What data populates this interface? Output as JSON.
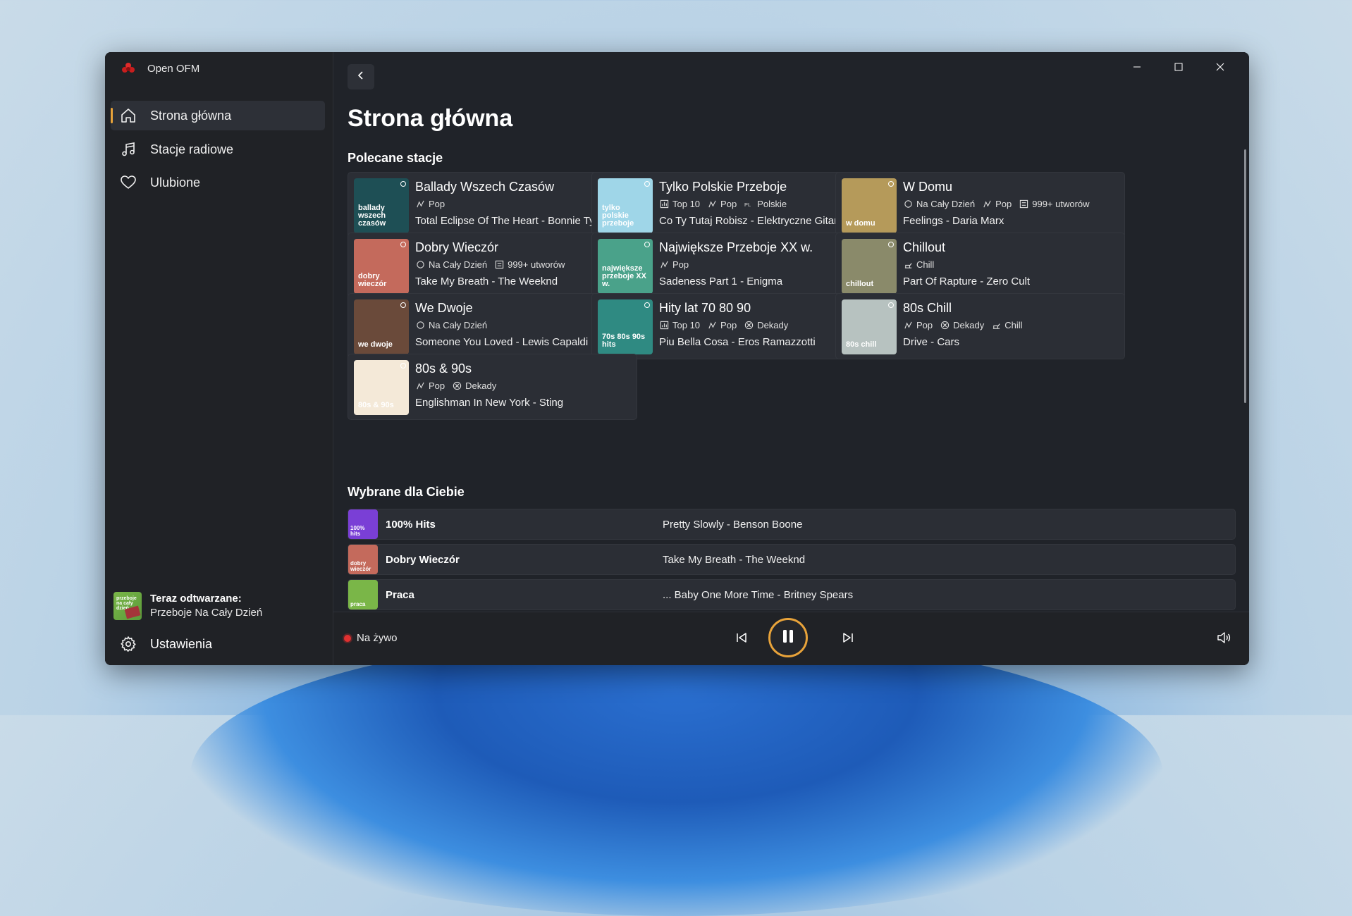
{
  "app": {
    "title": "Open OFM"
  },
  "nav": [
    {
      "label": "Strona główna",
      "icon": "home-icon",
      "active": true
    },
    {
      "label": "Stacje radiowe",
      "icon": "music-note-icon",
      "active": false
    },
    {
      "label": "Ulubione",
      "icon": "heart-icon",
      "active": false
    }
  ],
  "now_playing": {
    "label": "Teraz odtwarzane:",
    "station": "Przeboje Na Cały Dzień",
    "art_text": "przeboje na cały dzień"
  },
  "settings": {
    "label": "Ustawienia"
  },
  "main": {
    "title": "Strona główna",
    "featured_title": "Polecane stacje",
    "picked_title": "Wybrane dla Ciebie"
  },
  "featured": [
    {
      "name": "Ballady Wszech Czasów",
      "art_text": "ballady wszech czasów",
      "art_color": "#1e4f55",
      "tags": [
        {
          "icon": "genre-icon",
          "label": "Pop"
        }
      ],
      "song": "Total Eclipse Of The Heart - Bonnie Tyler"
    },
    {
      "name": "Tylko Polskie Przeboje",
      "art_text": "tylko polskie przeboje",
      "art_color": "#9fd6e8",
      "tags": [
        {
          "icon": "chart-icon",
          "label": "Top 10"
        },
        {
          "icon": "genre-icon",
          "label": "Pop"
        },
        {
          "icon": "pl-icon",
          "label": "Polskie"
        }
      ],
      "song": "Co Ty Tutaj Robisz - Elektryczne Gitary"
    },
    {
      "name": "W Domu",
      "art_text": "w domu",
      "art_color": "#b59a5a",
      "tags": [
        {
          "icon": "circle-icon",
          "label": "Na Cały Dzień"
        },
        {
          "icon": "genre-icon",
          "label": "Pop"
        },
        {
          "icon": "list-icon",
          "label": "999+ utworów"
        }
      ],
      "song": "Feelings - Daria Marx"
    },
    {
      "name": "Dobry Wieczór",
      "art_text": "dobry wieczór",
      "art_color": "#c46a5c",
      "tags": [
        {
          "icon": "circle-icon",
          "label": "Na Cały Dzień"
        },
        {
          "icon": "list-icon",
          "label": "999+ utworów"
        }
      ],
      "song": "Take My Breath - The Weeknd"
    },
    {
      "name": "Największe Przeboje XX w.",
      "art_text": "największe przeboje XX w.",
      "art_color": "#4aa28a",
      "tags": [
        {
          "icon": "genre-icon",
          "label": "Pop"
        }
      ],
      "song": "Sadeness Part 1 - Enigma"
    },
    {
      "name": "Chillout",
      "art_text": "chillout",
      "art_color": "#8a8a6a",
      "tags": [
        {
          "icon": "chill-icon",
          "label": "Chill"
        }
      ],
      "song": "Part Of Rapture - Zero Cult"
    },
    {
      "name": "We Dwoje",
      "art_text": "we dwoje",
      "art_color": "#6a4a3a",
      "tags": [
        {
          "icon": "circle-icon",
          "label": "Na Cały Dzień"
        }
      ],
      "song": "Someone You Loved - Lewis Capaldi"
    },
    {
      "name": "Hity lat 70 80 90",
      "art_text": "70s 80s 90s hits",
      "art_color": "#2f8a82",
      "tags": [
        {
          "icon": "chart-icon",
          "label": "Top 10"
        },
        {
          "icon": "genre-icon",
          "label": "Pop"
        },
        {
          "icon": "decade-icon",
          "label": "Dekady"
        }
      ],
      "song": "Piu Bella Cosa - Eros Ramazzotti"
    },
    {
      "name": "80s Chill",
      "art_text": "80s chill",
      "art_color": "#b7c2c0",
      "tags": [
        {
          "icon": "genre-icon",
          "label": "Pop"
        },
        {
          "icon": "decade-icon",
          "label": "Dekady"
        },
        {
          "icon": "chill-icon",
          "label": "Chill"
        }
      ],
      "song": "Drive - Cars"
    },
    {
      "name": "80s & 90s",
      "art_text": "80s & 90s",
      "art_color": "#f4e9d8",
      "tags": [
        {
          "icon": "genre-icon",
          "label": "Pop"
        },
        {
          "icon": "decade-icon",
          "label": "Dekady"
        }
      ],
      "song": "Englishman In New York - Sting"
    }
  ],
  "picked": [
    {
      "name": "100% Hits",
      "art_text": "100% hits",
      "art_color": "#7a3fd6",
      "song": "Pretty Slowly - Benson Boone"
    },
    {
      "name": "Dobry Wieczór",
      "art_text": "dobry wieczór",
      "art_color": "#c46a5c",
      "song": "Take My Breath - The Weeknd"
    },
    {
      "name": "Praca",
      "art_text": "praca",
      "art_color": "#7ab648",
      "song": "... Baby One More Time - Britney Spears"
    }
  ],
  "player": {
    "status": "Na żywo"
  }
}
